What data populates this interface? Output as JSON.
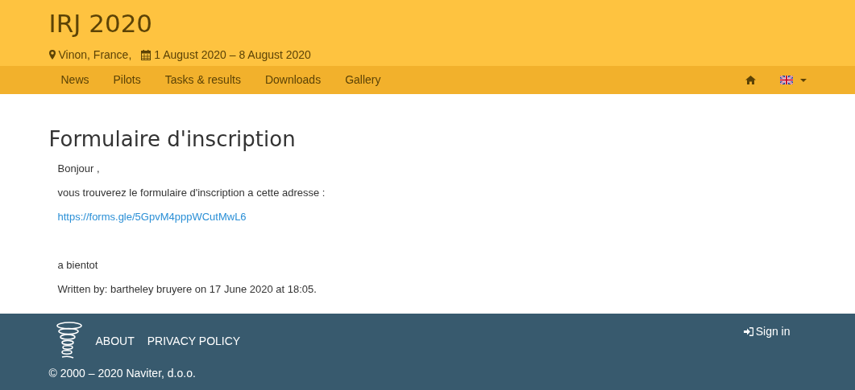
{
  "header": {
    "title": "IRJ 2020",
    "location": "Vinon, France,",
    "dates": "1 August 2020 – 8 August 2020"
  },
  "nav": {
    "items": [
      "News",
      "Pilots",
      "Tasks & results",
      "Downloads",
      "Gallery"
    ]
  },
  "article": {
    "title": "Formulaire d'inscription",
    "greeting": "Bonjour ,",
    "intro": "vous trouverez le formulaire d'inscription a cette adresse :",
    "link": "https://forms.gle/5GpvM4pppWCutMwL6",
    "closing": "a bientot",
    "byline": "Written by: bartheley bruyere on 17 June 2020 at 18:05."
  },
  "footer": {
    "links": [
      "ABOUT",
      "PRIVACY POLICY"
    ],
    "sign_in": "Sign in",
    "copyright": "© 2000 – 2020 Naviter, d.o.o."
  }
}
